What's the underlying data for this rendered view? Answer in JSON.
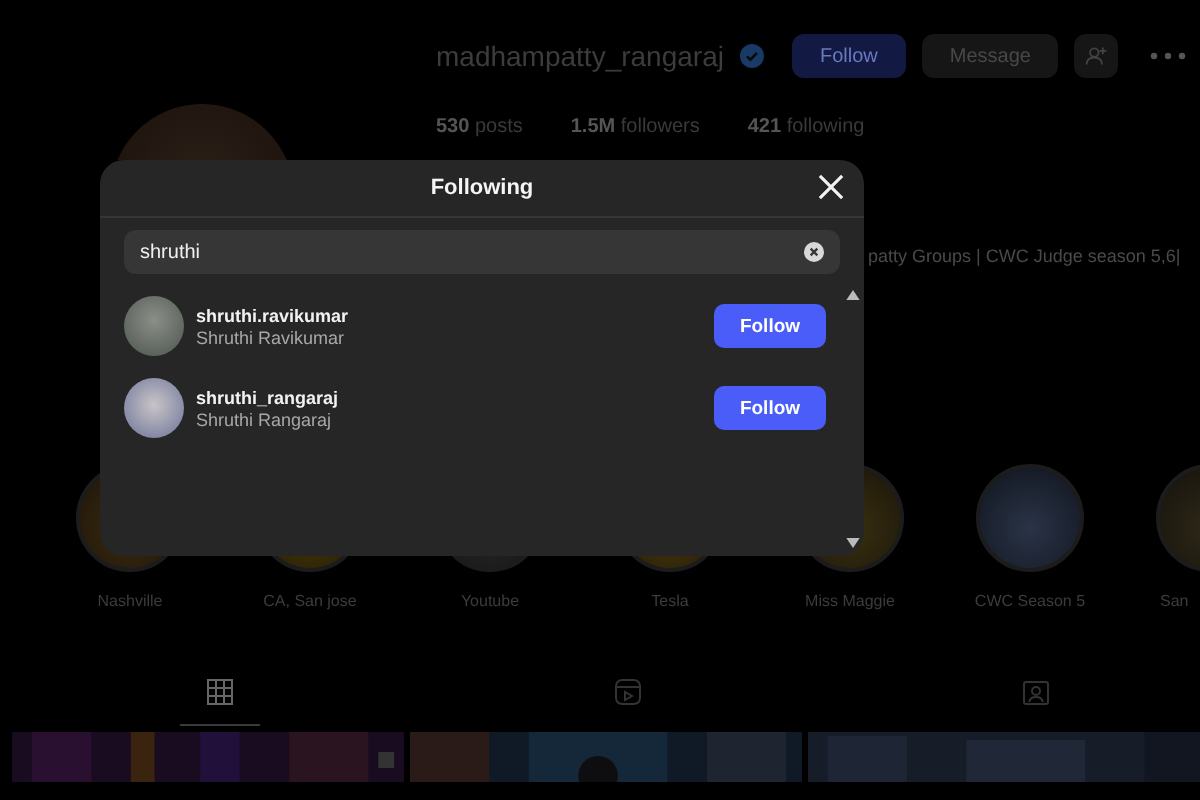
{
  "profile": {
    "username": "madhampatty_rangaraj",
    "verified": true,
    "buttons": [
      "Follow",
      "Message"
    ],
    "stats": [
      "**530** posts",
      "**1.5M** followers",
      "**421** following"
    ],
    "bio": "patty Groups | CWC Judge season 5,6|",
    "highlights": [
      "Nashville",
      "CA, San jose",
      "Youtube",
      "Tesla",
      "Miss Maggie",
      "CWC Season 5",
      "San"
    ],
    "tabs": [
      {
        "kind": "grid",
        "selected": true
      },
      {
        "kind": "reels",
        "selected": false
      },
      {
        "kind": "tagged",
        "selected": false
      }
    ],
    "posts": [
      {
        "kind": "picture"
      },
      {
        "kind": "picture"
      },
      {
        "kind": "picture"
      }
    ]
  },
  "modal": {
    "title": "Following",
    "search": {
      "value": "shruthi"
    },
    "users": [
      {
        "username": "shruthi.ravikumar",
        "name": "Shruthi Ravikumar",
        "button": "Follow"
      },
      {
        "username": "shruthi_rangaraj",
        "name": "Shruthi Rangaraj",
        "button": "Follow"
      }
    ]
  }
}
